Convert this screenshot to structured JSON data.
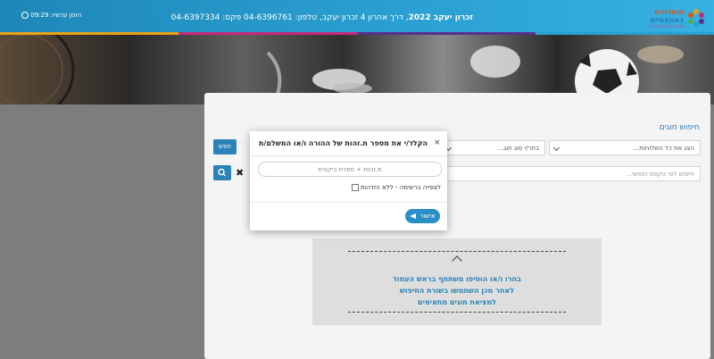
{
  "header": {
    "title_bold": "זכרון יעקב 2022",
    "title_rest": ", דרך אהרון 4 זכרון יעקב, טלפון: 04-6396761 פקס: 04-6397334",
    "clock_label": "הזמן עכשיו:",
    "clock_time": "09:29",
    "logo_line1": "מועדונים",
    "logo_line2": "באמצעיים",
    "logo_line3": "פעילויות חברתיות",
    "colors": {
      "header": "#2a9fd1",
      "accent": "#2a82b8"
    }
  },
  "search": {
    "title": "חיפוש חוגים",
    "branch_select": "הצג את כל השלוחות...",
    "type_select": "בחר/י סוג חוג...",
    "show_button": "חפש",
    "free_text_placeholder": "חיפוש לפי טקסט חופשי..."
  },
  "info": {
    "line1": "בחרו ו/או הוסיפו משתתף בראש העמוד",
    "line2": "לאחר מכן השתמשו בשורת החיפוש",
    "line3": "למציאת חוגים מתאימים"
  },
  "modal": {
    "title": "הקלד/י את מספר ת.זהות של ההורה ו/או המשלם/ת",
    "close": "×",
    "id_placeholder": "ת.זהות + ספרת ביקורת",
    "browse_label": "לצפייה ברשימה - ללא הזדהות",
    "confirm_label": "אישור"
  }
}
